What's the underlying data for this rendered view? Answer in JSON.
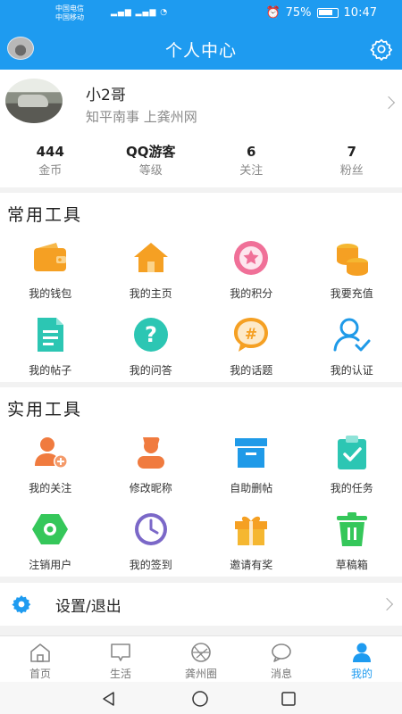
{
  "status_bar": {
    "carrier_1": "中国电信",
    "carrier_2": "中国移动",
    "battery": "75%",
    "time": "10:47"
  },
  "appbar": {
    "title": "个人中心"
  },
  "profile": {
    "name": "小2哥",
    "subtitle": "知平南事 上龚州网",
    "stats": [
      {
        "value": "444",
        "label": "金币"
      },
      {
        "value": "QQ游客",
        "label": "等级"
      },
      {
        "value": "6",
        "label": "关注"
      },
      {
        "value": "7",
        "label": "粉丝"
      }
    ]
  },
  "common_tools": {
    "title": "常用工具",
    "items": [
      {
        "label": "我的钱包",
        "icon": "wallet-icon"
      },
      {
        "label": "我的主页",
        "icon": "home-icon"
      },
      {
        "label": "我的积分",
        "icon": "star-points-icon"
      },
      {
        "label": "我要充值",
        "icon": "coins-icon"
      },
      {
        "label": "我的帖子",
        "icon": "document-icon"
      },
      {
        "label": "我的问答",
        "icon": "question-icon"
      },
      {
        "label": "我的话题",
        "icon": "hashtag-icon"
      },
      {
        "label": "我的认证",
        "icon": "verified-user-icon"
      }
    ]
  },
  "practical_tools": {
    "title": "实用工具",
    "items": [
      {
        "label": "我的关注",
        "icon": "add-user-icon"
      },
      {
        "label": "修改昵称",
        "icon": "user-edit-icon"
      },
      {
        "label": "自助删帖",
        "icon": "archive-box-icon"
      },
      {
        "label": "我的任务",
        "icon": "task-clipboard-icon"
      },
      {
        "label": "注销用户",
        "icon": "hexagon-icon"
      },
      {
        "label": "我的签到",
        "icon": "clock-icon"
      },
      {
        "label": "邀请有奖",
        "icon": "gift-icon"
      },
      {
        "label": "草稿箱",
        "icon": "trash-bin-icon"
      }
    ]
  },
  "settings": {
    "label": "设置/退出"
  },
  "bottom_nav": {
    "items": [
      {
        "label": "首页",
        "icon": "home-outline-icon"
      },
      {
        "label": "生活",
        "icon": "life-chat-icon"
      },
      {
        "label": "龚州圈",
        "icon": "circle-aperture-icon"
      },
      {
        "label": "消息",
        "icon": "message-bubble-icon"
      },
      {
        "label": "我的",
        "icon": "person-icon"
      }
    ],
    "active": "我的"
  },
  "colors": {
    "primary": "#1e9bf0",
    "orange": "#f5a023",
    "pink": "#f07098",
    "teal": "#2cc6b3",
    "blue_icon": "#1f9ae8",
    "green": "#35c75a",
    "purple": "#7b68c8"
  }
}
